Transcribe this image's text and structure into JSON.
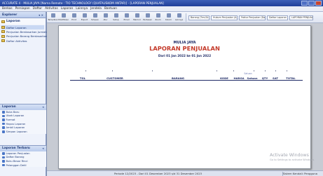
{
  "window": {
    "title": "ACCURATE 4 - MULIA JAYA [Nama Remote : TIO TECHNOLOGY (QUATAUSKOM ANTAR)] - [LAPORAN PENJUALAN]"
  },
  "menu": [
    "Berkas",
    "Persiapan",
    "Daftar",
    "Aktivitas",
    "Laporan",
    "Lainnya",
    "Jendela",
    "Bantuan"
  ],
  "sidebar": {
    "title": "Explorer",
    "tree_title": "Laporan",
    "tree_items": [
      "Daftar Laporan",
      "Penjualan Berdasarkan Jumlah",
      "Penjualan Barang Berdasarkan Pelanggan",
      "Daftar Aktivitas"
    ]
  },
  "task_panels": [
    {
      "title": "Laporan",
      "items": [
        "Buka Baru",
        "Ubah Laporan",
        "Format",
        "Hapus Laporan",
        "Ambil Laporan",
        "Simpan Laporan"
      ]
    },
    {
      "title": "Laporan Terbaru",
      "items": [
        "Laporan Penjualan",
        "Daftar Barang",
        "Buku Besar Rinci",
        "Pelanggan Detil"
      ]
    }
  ],
  "toolbar": {
    "buttons": [
      "Tampilkan",
      "Modifikasi",
      "Print",
      "Export",
      "Simpan",
      "Atur",
      "Setup",
      "Email",
      "Memoir",
      "Perbesar",
      "Zoom",
      "Kolom",
      "Lainnya"
    ],
    "combos": [
      "Barang (Tmr/Grs)",
      "Hukum Penjualan (A...",
      "Faktur Penjualan (Da...",
      "Daftar Laporan",
      "LAPORAN PENJUALAN"
    ]
  },
  "report": {
    "company": "MULIA JAYA",
    "title": "LAPORAN PENJUALAN",
    "period": "Dari 01 Jan 2022 ke 01 Jan 2022",
    "columns": [
      "TGL",
      "CUSTOMER",
      "BARANG",
      "KODE",
      "HARGA",
      "Satuan",
      "QTY",
      "SAT",
      "TOTAL"
    ],
    "subheaders": {
      "satuan_note": "Satuan",
      "satuan_label": "Satuan"
    }
  },
  "statusbar": {
    "left": "Periode 12/2023 - Dari 01 Desember 2023 s/d 31 Desember 2023",
    "right": "Sistem Kendali: Pengguna"
  },
  "watermark": {
    "line1": "Activate Windows",
    "line2": "Go to Settings to activate Windows."
  },
  "colors": {
    "title_bar": "#2a4ba8",
    "report_title": "#c43b2b",
    "report_text": "#1e2a66"
  }
}
